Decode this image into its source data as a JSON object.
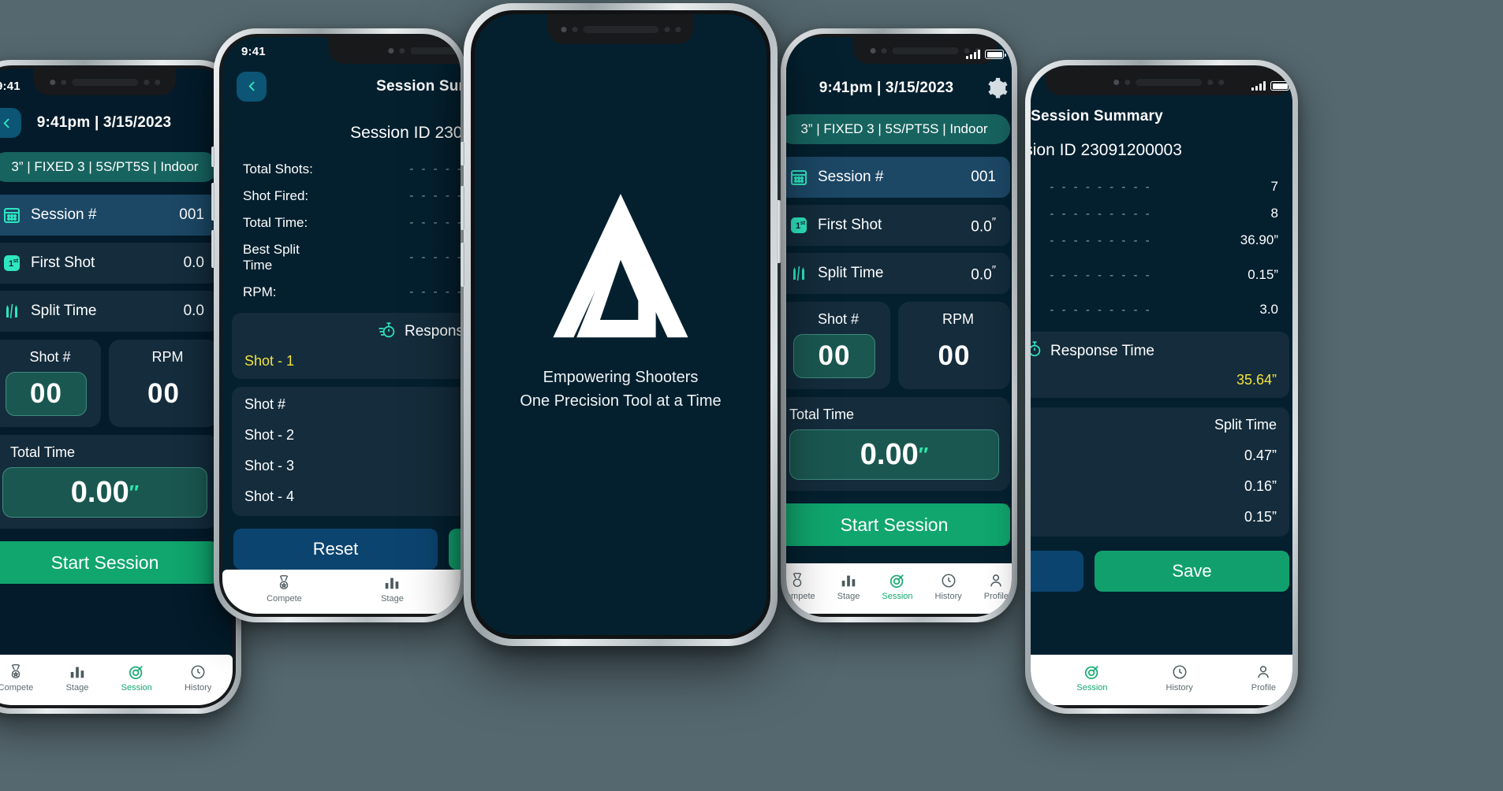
{
  "brand": {
    "accent_green": "#10a66e",
    "accent_teal": "#2ee6a8",
    "card_bg": "#142c3c",
    "screen_bg": "#04202e",
    "highlight_yellow": "#f2e33a",
    "chip_bg": "#17635f",
    "logo_name": "triangle-logo"
  },
  "splash": {
    "tagline_line1": "Empowering Shooters",
    "tagline_line2": "One Precision Tool at a Time"
  },
  "session_screen": {
    "status_time": "9:41",
    "header_title": "9:41pm | 3/15/2023",
    "chip": "3” | FIXED 3 | 5S/PT5S | Indoor",
    "rows": [
      {
        "icon": "calendar-icon",
        "label": "Session #",
        "value": "001"
      },
      {
        "icon": "first-shot-icon",
        "label": "First Shot",
        "value": "0.0",
        "unit": "″"
      },
      {
        "icon": "split-time-icon",
        "label": "Split Time",
        "value": "0.0",
        "unit": "″"
      }
    ],
    "metrics": [
      {
        "icon": "pistol-icon",
        "label": "Shot #",
        "value": "00"
      },
      {
        "icon": "bullets-icon",
        "label": "RPM",
        "value": "00"
      }
    ],
    "total": {
      "icon": "stopwatch-icon",
      "label": "Total Time",
      "value": "0.00",
      "unit": "″"
    },
    "start_button": "Start Session",
    "tabs": [
      {
        "name": "compete",
        "label": "Compete",
        "icon": "medal-icon",
        "active": false
      },
      {
        "name": "stage",
        "label": "Stage",
        "icon": "bars-icon",
        "active": false
      },
      {
        "name": "session",
        "label": "Session",
        "icon": "target-icon",
        "active": true
      },
      {
        "name": "history",
        "label": "History",
        "icon": "clock-icon",
        "active": false
      },
      {
        "name": "profile",
        "label": "Profile",
        "icon": "person-icon",
        "active": false
      }
    ]
  },
  "summary_screen": {
    "status_time": "9:41",
    "header_title": "Session Summary",
    "session_id": "Session ID 23091200003",
    "rows": [
      {
        "label": "Total Shots:",
        "dashes": "- - - - - - - - -",
        "value": "7"
      },
      {
        "label": "Shot Fired:",
        "dashes": "- - - - - - - - -",
        "value": "8"
      },
      {
        "label": "Total Time:",
        "dashes": "- - - - - - - - -",
        "value": "36.90”"
      },
      {
        "label": "Best Split Time",
        "dashes": "- - - - - - - - -",
        "value": "0.15”"
      },
      {
        "label": "RPM:",
        "dashes": "- - - - - - - - -",
        "value": "3.0"
      }
    ],
    "response": {
      "icon": "response-time-icon",
      "title": "Response Time",
      "shot_label": "Shot  - 1",
      "shot_value": "35.64”"
    },
    "split_header": {
      "left": "Shot #",
      "right": "Split Time"
    },
    "splits": [
      {
        "label": "Shot  - 2",
        "value": "0.47”"
      },
      {
        "label": "Shot  - 3",
        "value": "0.16”"
      },
      {
        "label": "Shot  - 4",
        "value": "0.15”"
      }
    ],
    "reset_button": "Reset",
    "save_button": "Save"
  }
}
